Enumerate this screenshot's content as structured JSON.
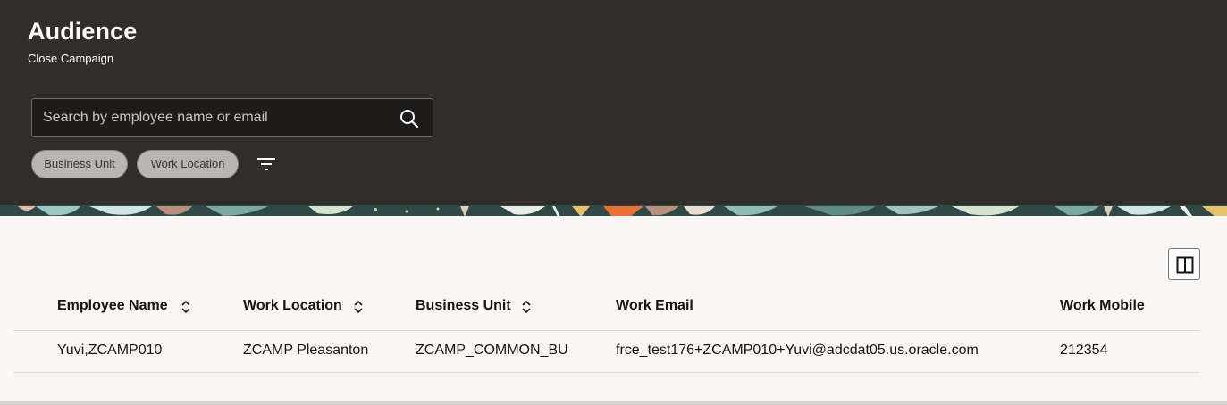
{
  "header": {
    "title": "Audience",
    "subtitle": "Close Campaign"
  },
  "search": {
    "placeholder": "Search by employee name or email",
    "value": ""
  },
  "filters": {
    "chips": [
      "Business Unit",
      "Work Location"
    ]
  },
  "table": {
    "columns": [
      "Employee Name",
      "Work Location",
      "Business Unit",
      "Work Email",
      "Work Mobile"
    ],
    "rows": [
      [
        "Yuvi,ZCAMP010",
        "ZCAMP Pleasanton",
        "ZCAMP_COMMON_BU",
        "frce_test176+ZCAMP010+Yuvi@adcdat05.us.oracle.com",
        "212354"
      ]
    ]
  },
  "icons": {
    "search": "search-icon",
    "filter": "filter-icon",
    "columns": "column-layout-icon",
    "sort": "sort-icon"
  },
  "colors": {
    "header_bg": "#312d2a",
    "page_bg": "#f9f8f6",
    "chip_bg": "#b9b6b1"
  }
}
